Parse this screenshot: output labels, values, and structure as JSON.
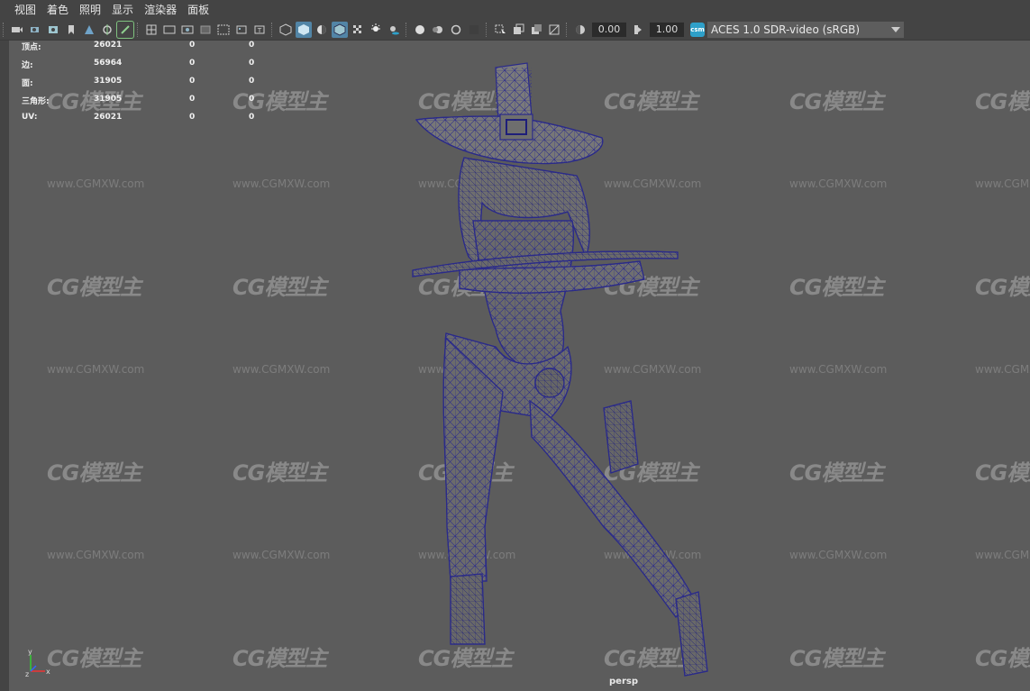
{
  "menu": [
    "视图",
    "着色",
    "照明",
    "显示",
    "渲染器",
    "面板"
  ],
  "toolbar": {
    "exposure_value": "0.00",
    "gamma_value": "1.00",
    "colorspace_badge": "csm",
    "colorspace_label": "ACES 1.0 SDR-video (sRGB)"
  },
  "hud": {
    "rows": [
      {
        "label": "顶点:",
        "v1": "26021",
        "v2": "0",
        "v3": "0"
      },
      {
        "label": "边:",
        "v1": "56964",
        "v2": "0",
        "v3": "0"
      },
      {
        "label": "面:",
        "v1": "31905",
        "v2": "0",
        "v3": "0"
      },
      {
        "label": "三角形:",
        "v1": "31905",
        "v2": "0",
        "v3": "0"
      },
      {
        "label": "UV:",
        "v1": "26021",
        "v2": "0",
        "v3": "0"
      }
    ]
  },
  "viewport": {
    "camera_label": "persp",
    "axis": {
      "x": "x",
      "y": "y",
      "z": "z"
    }
  },
  "watermark": {
    "logo_text": "CG模型主",
    "url_text": "www.CGMXW.com"
  },
  "colors": {
    "background": "#5c5c5c",
    "wireframe": "#2c2c8c",
    "highlight": "#5285a6"
  }
}
